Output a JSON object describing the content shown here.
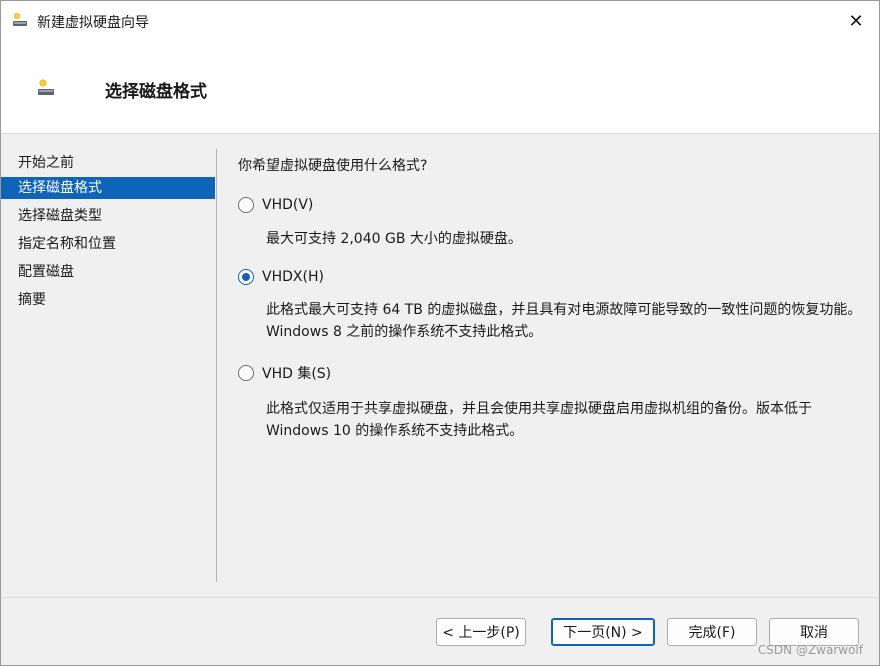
{
  "window": {
    "title": "新建虚拟硬盘向导"
  },
  "header": {
    "title": "选择磁盘格式"
  },
  "nav": {
    "items": [
      {
        "label": "开始之前"
      },
      {
        "label": "选择磁盘格式"
      },
      {
        "label": "选择磁盘类型"
      },
      {
        "label": "指定名称和位置"
      },
      {
        "label": "配置磁盘"
      },
      {
        "label": "摘要"
      }
    ],
    "active_index": 1
  },
  "main": {
    "question": "你希望虚拟硬盘使用什么格式?",
    "options": [
      {
        "label": "VHD(V)",
        "desc": "最大可支持 2,040 GB 大小的虚拟硬盘。",
        "checked": false
      },
      {
        "label": "VHDX(H)",
        "desc": "此格式最大可支持 64 TB 的虚拟磁盘，并且具有对电源故障可能导致的一致性问题的恢复功能。Windows 8 之前的操作系统不支持此格式。",
        "checked": true
      },
      {
        "label": "VHD 集(S)",
        "desc": "此格式仅适用于共享虚拟硬盘，并且会使用共享虚拟硬盘启用虚拟机组的备份。版本低于 Windows 10 的操作系统不支持此格式。",
        "checked": false
      }
    ]
  },
  "buttons": {
    "prev": "< 上一步(P)",
    "next": "下一页(N) >",
    "finish": "完成(F)",
    "cancel": "取消"
  },
  "watermark": "CSDN @Zwarwolf",
  "colors": {
    "accent": "#0f63b8",
    "background": "#f0f0f0"
  },
  "icons": {
    "app": "disk-wizard-icon",
    "close": "close-icon"
  }
}
